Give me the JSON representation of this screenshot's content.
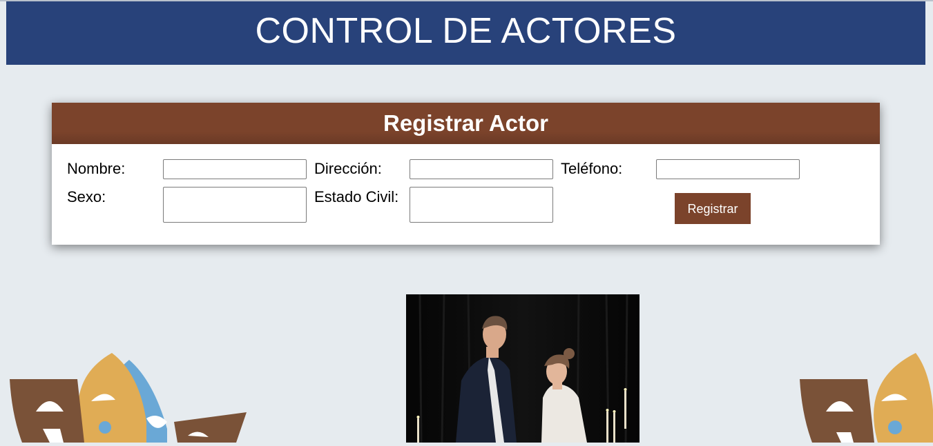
{
  "header": {
    "title": "CONTROL DE ACTORES"
  },
  "form": {
    "title": "Registrar Actor",
    "fields": {
      "nombre": {
        "label": "Nombre:",
        "value": ""
      },
      "direccion": {
        "label": "Dirección:",
        "value": ""
      },
      "telefono": {
        "label": "Teléfono:",
        "value": ""
      },
      "sexo": {
        "label": "Sexo:",
        "value": ""
      },
      "estado_civil": {
        "label": "Estado Civil:",
        "value": ""
      }
    },
    "submit_label": "Registrar"
  },
  "images": {
    "photo": "theater-actors-photo",
    "decoration": "theater-masks-icon"
  },
  "colors": {
    "header_bg": "#28427a",
    "panel_header_bg": "#7b432b",
    "button_bg": "#7b432b",
    "page_bg": "#e6ebef"
  }
}
